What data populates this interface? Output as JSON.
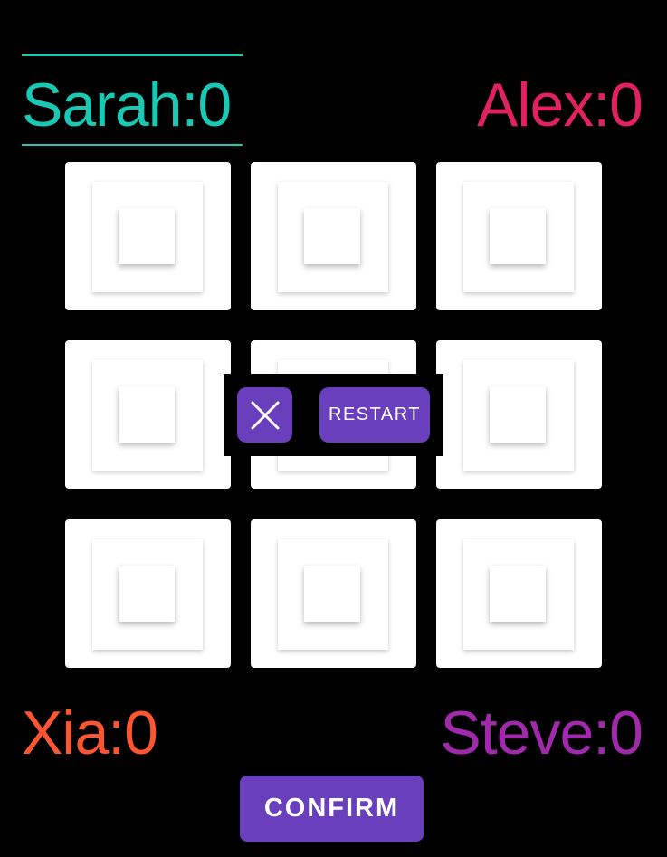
{
  "players": {
    "top_left": "Sarah:0",
    "top_right": "Alex:0",
    "bottom_left": "Xia:0",
    "bottom_right": "Steve:0"
  },
  "player_colors": {
    "sarah": "#19c9b4",
    "alex": "#e0235f",
    "xia": "#fb5630",
    "steve": "#a12aac"
  },
  "active_player": "Sarah",
  "board": {
    "cells": [
      "",
      "",
      "",
      "",
      "",
      "",
      "",
      "",
      ""
    ]
  },
  "popup": {
    "close_icon": "close-icon",
    "restart_label": "RESTART"
  },
  "confirm_label": "CONFIRM",
  "accent": "#6a3fbd"
}
